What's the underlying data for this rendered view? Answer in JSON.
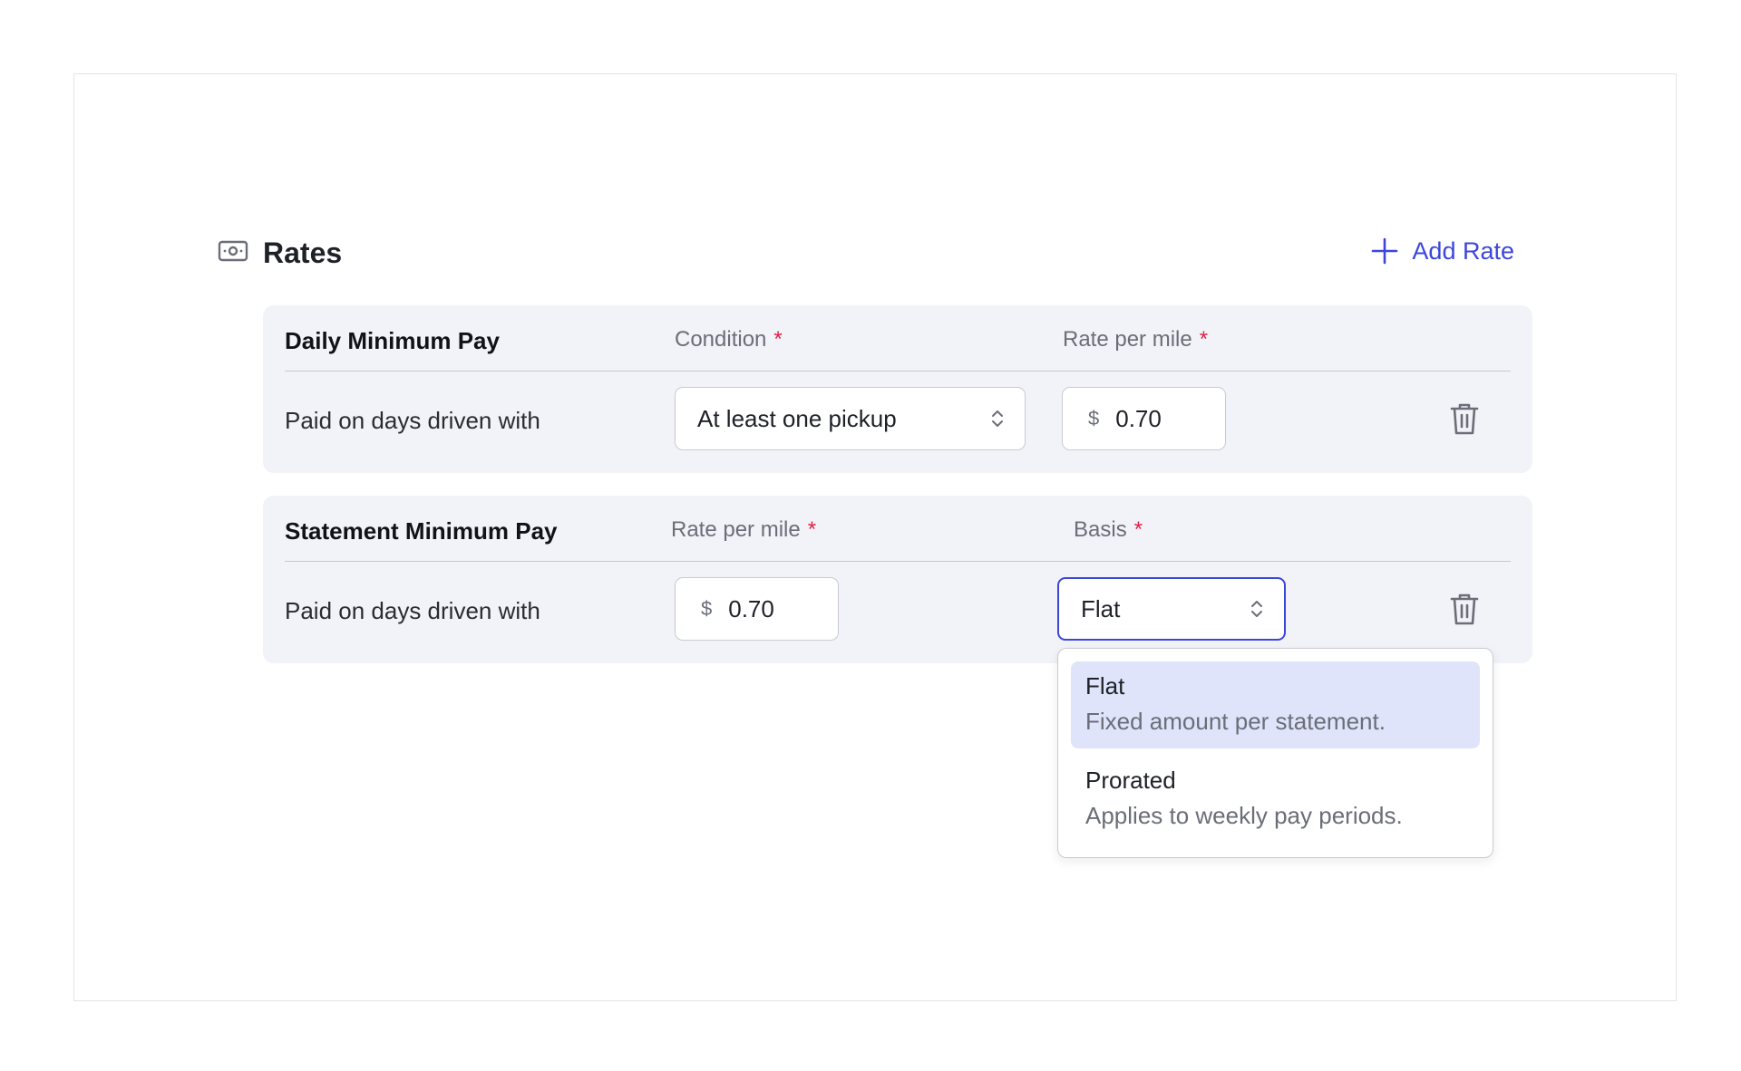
{
  "section": {
    "title": "Rates",
    "icon": "money-icon",
    "add_button": {
      "label": "Add Rate",
      "icon": "plus-icon"
    }
  },
  "cards": [
    {
      "title": "Daily Minimum Pay",
      "columns": [
        {
          "label": "Condition",
          "required": "*"
        },
        {
          "label": "Rate per mile",
          "required": "*"
        }
      ],
      "row_label": "Paid on days driven with",
      "condition": {
        "value": "At least one pickup"
      },
      "rate": {
        "currency": "$",
        "value": "0.70"
      }
    },
    {
      "title": "Statement Minimum Pay",
      "columns": [
        {
          "label": "Rate per mile",
          "required": "*"
        },
        {
          "label": "Basis",
          "required": "*"
        }
      ],
      "row_label": "Paid on days driven with",
      "rate": {
        "currency": "$",
        "value": "0.70"
      },
      "basis": {
        "value": "Flat"
      }
    }
  ],
  "basis_dropdown": {
    "options": [
      {
        "title": "Flat",
        "description": "Fixed amount per statement.",
        "selected": true
      },
      {
        "title": "Prorated",
        "description": "Applies to weekly pay periods.",
        "selected": false
      }
    ]
  },
  "colors": {
    "accent": "#3c46dc",
    "required": "#e11d48",
    "card_bg": "#f2f3f8",
    "selected_option_bg": "#e0e4fb"
  }
}
